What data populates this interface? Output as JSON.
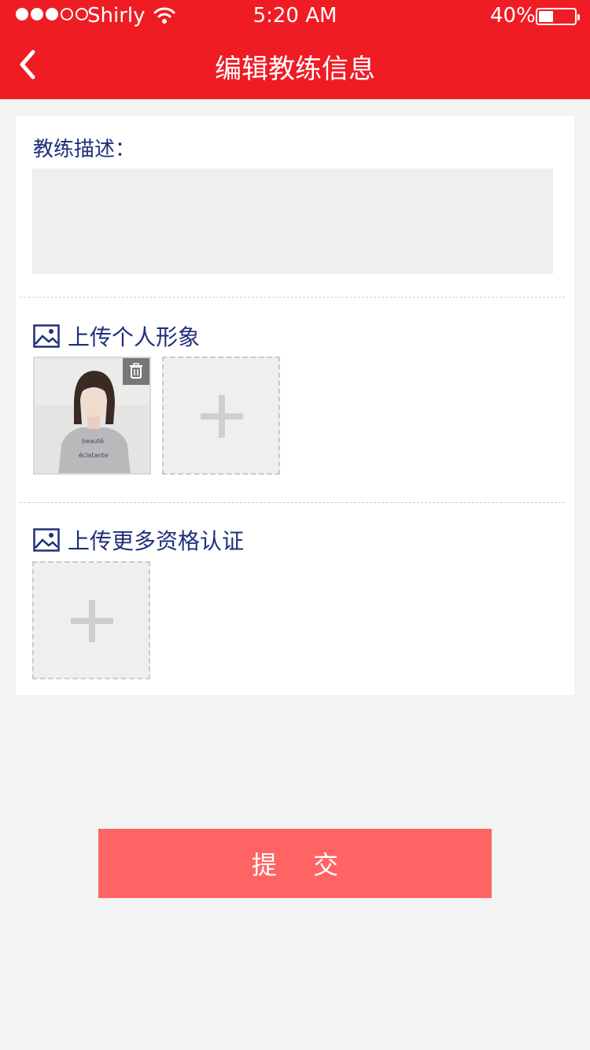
{
  "status_bar": {
    "carrier": "Shirly",
    "time": "5:20 AM",
    "battery": "40%",
    "battery_level": 0.4,
    "signal_bars_filled": 3,
    "signal_bars_total": 5
  },
  "nav": {
    "title": "编辑教练信息",
    "back_icon": "chevron-left-icon"
  },
  "form": {
    "description_label": "教练描述：",
    "description_value": "",
    "personal_image_section": {
      "title": "上传个人形象",
      "icon": "image-icon",
      "photos": [
        {
          "delete_icon": "trash-icon"
        }
      ],
      "add_icon": "plus-icon"
    },
    "qualification_section": {
      "title": "上传更多资格认证",
      "icon": "image-icon",
      "add_icon": "plus-icon"
    }
  },
  "submit_label": "提 交",
  "colors": {
    "header": "#ef1c24",
    "accent_text": "#1f2f7a",
    "submit": "#ff6464",
    "background": "#f3f3f3"
  }
}
